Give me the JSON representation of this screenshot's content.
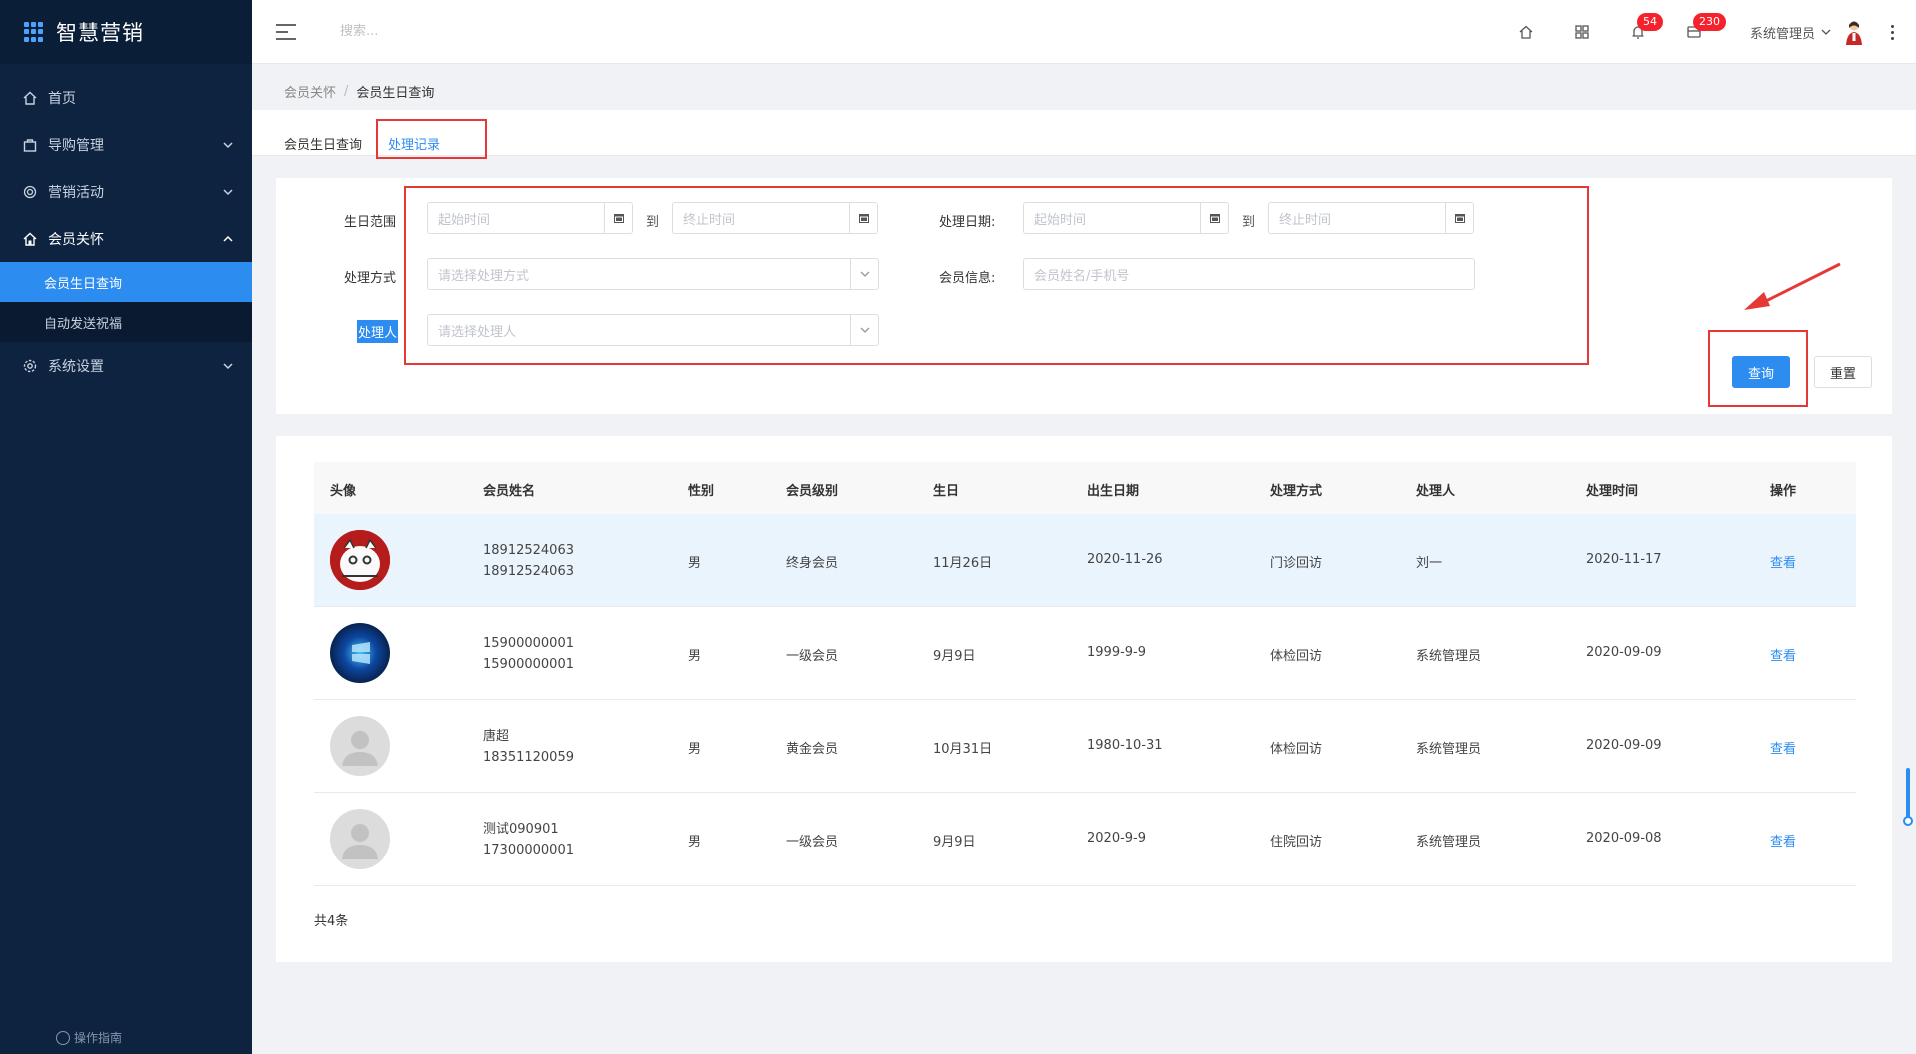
{
  "app": {
    "title": "智慧营销"
  },
  "sidebar": {
    "items": [
      {
        "label": "首页",
        "icon": "home-icon"
      },
      {
        "label": "导购管理",
        "icon": "bag-icon"
      },
      {
        "label": "营销活动",
        "icon": "target-icon"
      },
      {
        "label": "会员关怀",
        "icon": "home-heart-icon"
      }
    ],
    "sub_items": [
      {
        "label": "会员生日查询",
        "active": true
      },
      {
        "label": "自动发送祝福",
        "active": false
      }
    ],
    "settings": {
      "label": "系统设置",
      "icon": "gear-icon"
    },
    "guide": "操作指南"
  },
  "header": {
    "search_placeholder": "搜索...",
    "badges": {
      "notifications": "54",
      "messages": "230"
    },
    "user": "系统管理员"
  },
  "breadcrumb": {
    "parent": "会员关怀",
    "separator": "/",
    "current": "会员生日查询"
  },
  "tabs": [
    {
      "label": "会员生日查询"
    },
    {
      "label": "处理记录",
      "active": true
    }
  ],
  "filters": {
    "birthday_range_label": "生日范围",
    "start_placeholder": "起始时间",
    "end_placeholder": "终止时间",
    "to": "到",
    "process_date_label": "处理日期:",
    "process_method_label": "处理方式",
    "process_method_placeholder": "请选择处理方式",
    "member_info_label": "会员信息:",
    "member_info_placeholder": "会员姓名/手机号",
    "handler_label": "处理人",
    "handler_placeholder": "请选择处理人"
  },
  "buttons": {
    "query": "查询",
    "reset": "重置"
  },
  "table": {
    "headers": [
      "头像",
      "会员姓名",
      "性别",
      "会员级别",
      "生日",
      "出生日期",
      "处理方式",
      "处理人",
      "处理时间",
      "操作"
    ],
    "rows": [
      {
        "name": "18912524063",
        "phone": "18912524063",
        "gender": "男",
        "level": "终身会员",
        "birthday": "11月26日",
        "birth_date": "2020-11-26",
        "method": "门诊回访",
        "handler": "刘一",
        "time": "2020-11-17",
        "action": "查看",
        "avatar": "cartoon"
      },
      {
        "name": "15900000001",
        "phone": "15900000001",
        "gender": "男",
        "level": "一级会员",
        "birthday": "9月9日",
        "birth_date": "1999-9-9",
        "method": "体检回访",
        "handler": "系统管理员",
        "time": "2020-09-09",
        "action": "查看",
        "avatar": "windows"
      },
      {
        "name": "唐超",
        "phone": "18351120059",
        "gender": "男",
        "level": "黄金会员",
        "birthday": "10月31日",
        "birth_date": "1980-10-31",
        "method": "体检回访",
        "handler": "系统管理员",
        "time": "2020-09-09",
        "action": "查看",
        "avatar": "default"
      },
      {
        "name": "测试090901",
        "phone": "17300000001",
        "gender": "男",
        "level": "一级会员",
        "birthday": "9月9日",
        "birth_date": "2020-9-9",
        "method": "住院回访",
        "handler": "系统管理员",
        "time": "2020-09-08",
        "action": "查看",
        "avatar": "default"
      }
    ],
    "total": "共4条"
  },
  "colors": {
    "sidebar_bg": "#0d2340",
    "primary": "#2d8cf0",
    "annotation": "#e53935"
  }
}
